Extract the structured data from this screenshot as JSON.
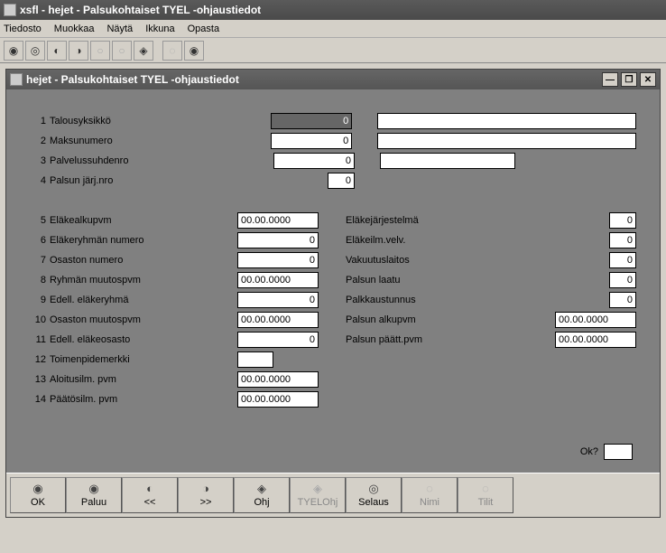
{
  "app_title": "xsfl - hejet - Palsukohtaiset TYEL -ohjaustiedot",
  "menu": {
    "tiedosto": "Tiedosto",
    "muokkaa": "Muokkaa",
    "nayta": "Näytä",
    "ikkuna": "Ikkuna",
    "opasta": "Opasta"
  },
  "win_title": "hejet - Palsukohtaiset TYEL -ohjaustiedot",
  "labels": {
    "l1": "Talousyksikkö",
    "l2": "Maksunumero",
    "l3": "Palvelussuhdenro",
    "l4": "Palsun järj.nro",
    "l5": "Eläkealkupvm",
    "l6": "Eläkeryhmän numero",
    "l7": "Osaston numero",
    "l8": "Ryhmän muutospvm",
    "l9": "Edell. eläkeryhmä",
    "l10": "Osaston muutospvm",
    "l11": "Edell. eläkeosasto",
    "l12": "Toimenpidemerkki",
    "l13": "Aloitusilm. pvm",
    "l14": "Päätösilm. pvm",
    "r5": "Eläkejärjestelmä",
    "r6": "Eläkeilm.velv.",
    "r7": "Vakuutuslaitos",
    "r8": "Palsun laatu",
    "r9": "Palkkaustunnus",
    "r10": "Palsun alkupvm",
    "r11": "Palsun päätt.pvm",
    "ok": "Ok?"
  },
  "nums": {
    "n1": "1",
    "n2": "2",
    "n3": "3",
    "n4": "4",
    "n5": "5",
    "n6": "6",
    "n7": "7",
    "n8": "8",
    "n9": "9",
    "n10": "10",
    "n11": "11",
    "n12": "12",
    "n13": "13",
    "n14": "14"
  },
  "values": {
    "v1": "0",
    "v1b": "",
    "v2": "0",
    "v2b": "",
    "v3": "0",
    "v3b": "",
    "v4": "0",
    "v5": "00.00.0000",
    "v6": "0",
    "v7": "0",
    "v8": "00.00.0000",
    "v9": "0",
    "v10": "00.00.0000",
    "v11": "0",
    "v12": "",
    "v13": "00.00.0000",
    "v14": "00.00.0000",
    "rv5": "0",
    "rv6": "0",
    "rv7": "0",
    "rv8": "0",
    "rv9": "0",
    "rv10": "00.00.0000",
    "rv11": "00.00.0000"
  },
  "buttons": {
    "ok": "OK",
    "paluu": "Paluu",
    "prev": "<<",
    "next": ">>",
    "ohj": "Ohj",
    "tyelohj": "TYELOhj",
    "selaus": "Selaus",
    "nimi": "Nimi",
    "tilit": "Tilit"
  }
}
